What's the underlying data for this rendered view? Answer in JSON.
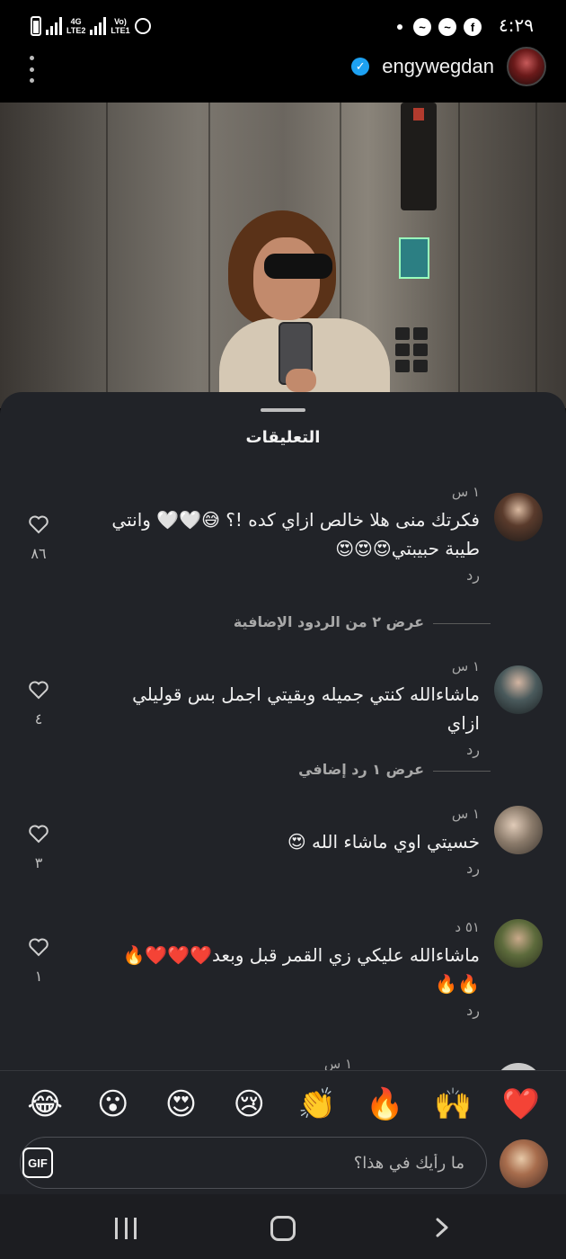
{
  "status_bar": {
    "time": "٤:٢٩",
    "network_1": "4G\nLTE2",
    "network_2": "Vo)\nLTE1",
    "app_icons": [
      "messenger-icon",
      "messenger-icon",
      "facebook-icon"
    ]
  },
  "header": {
    "username": "engywegdan",
    "verified": true
  },
  "comments_sheet": {
    "title": "التعليقات",
    "comments": [
      {
        "time": "١ س",
        "text": "فكرتك منى هلا خالص ازاي كده !؟ 😅🤍🤍 وانتي طيبة حبيبتي😍😍😍",
        "reply_label": "رد",
        "likes": "٨٦",
        "avatar_color": "#6b5a4e"
      },
      {
        "time": "١ س",
        "text": "ماشاءالله كنتي جميله وبقيتي اجمل بس قوليلي ازاي",
        "reply_label": "رد",
        "likes": "٤",
        "avatar_color": "#3b4a4c"
      },
      {
        "time": "١ س",
        "text": "خسيتي اوي ماشاء الله 😍",
        "reply_label": "رد",
        "likes": "٣",
        "avatar_color": "#8b7b6c"
      },
      {
        "time": "٥١ د",
        "text": "ماشاءالله عليكي زي القمر قبل وبعد❤️❤️❤️🔥🔥🔥",
        "reply_label": "رد",
        "likes": "١",
        "avatar_color": "#4a5d3a"
      }
    ],
    "more_replies": [
      "عرض ٢ من الردود الإضافية",
      "عرض ١ رد إضافي"
    ],
    "partial_next_time": "١ س"
  },
  "quick_reactions": [
    "❤️",
    "🙌",
    "🔥",
    "👏",
    "😢",
    "😍",
    "😮",
    "😂"
  ],
  "comment_input": {
    "placeholder": "ما رأيك في هذا؟",
    "gif_label": "GIF"
  }
}
